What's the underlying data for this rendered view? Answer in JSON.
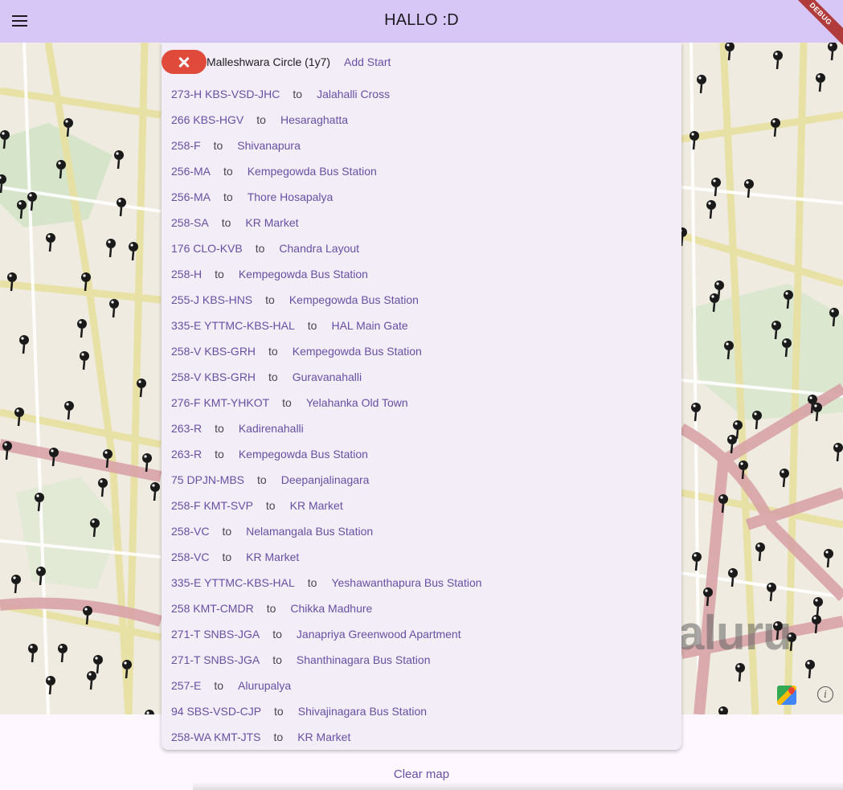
{
  "app_bar": {
    "title": "HALLO :D",
    "menu_icon": "menu-icon",
    "debug_banner": "DEBUG"
  },
  "map": {
    "watermark": "aluru",
    "google_maps_icon": "google-maps-icon",
    "info_icon": "info-icon",
    "colors": {
      "road_major": "#d4a0a0",
      "road_minor": "#e8e0a0",
      "park": "#cfe4c4",
      "marker": "#1a1a1a"
    }
  },
  "panel": {
    "close_icon": "close-icon",
    "stop_name": "Malleshwara Circle (1y7)",
    "add_start_label": "Add Start",
    "connector": "to",
    "routes": [
      {
        "number": "273-H KBS-VSD-JHC",
        "destination": "Jalahalli Cross"
      },
      {
        "number": "266 KBS-HGV",
        "destination": "Hesaraghatta"
      },
      {
        "number": "258-F",
        "destination": "Shivanapura"
      },
      {
        "number": "256-MA",
        "destination": "Kempegowda Bus Station"
      },
      {
        "number": "256-MA",
        "destination": "Thore Hosapalya"
      },
      {
        "number": "258-SA",
        "destination": "KR Market"
      },
      {
        "number": "176 CLO-KVB",
        "destination": "Chandra Layout"
      },
      {
        "number": "258-H",
        "destination": "Kempegowda Bus Station"
      },
      {
        "number": "255-J KBS-HNS",
        "destination": "Kempegowda Bus Station"
      },
      {
        "number": "335-E YTTMC-KBS-HAL",
        "destination": "HAL Main Gate"
      },
      {
        "number": "258-V KBS-GRH",
        "destination": "Kempegowda Bus Station"
      },
      {
        "number": "258-V KBS-GRH",
        "destination": "Guravanahalli"
      },
      {
        "number": "276-F KMT-YHKOT",
        "destination": "Yelahanka Old Town"
      },
      {
        "number": "263-R",
        "destination": "Kadirenahalli"
      },
      {
        "number": "263-R",
        "destination": "Kempegowda Bus Station"
      },
      {
        "number": "75 DPJN-MBS",
        "destination": "Deepanjalinagara"
      },
      {
        "number": "258-F KMT-SVP",
        "destination": "KR Market"
      },
      {
        "number": "258-VC",
        "destination": "Nelamangala Bus Station"
      },
      {
        "number": "258-VC",
        "destination": "KR Market"
      },
      {
        "number": "335-E YTTMC-KBS-HAL",
        "destination": "Yeshawanthapura Bus Station"
      },
      {
        "number": "258 KMT-CMDR",
        "destination": "Chikka Madhure"
      },
      {
        "number": "271-T SNBS-JGA",
        "destination": "Janapriya Greenwood Apartment"
      },
      {
        "number": "271-T SNBS-JGA",
        "destination": "Shanthinagara Bus Station"
      },
      {
        "number": "257-E",
        "destination": "Alurupalya"
      },
      {
        "number": "94 SBS-VSD-CJP",
        "destination": "Shivajinagara Bus Station"
      },
      {
        "number": "258-WA KMT-JTS",
        "destination": "KR Market"
      }
    ]
  },
  "footer": {
    "clear_map_label": "Clear map"
  }
}
